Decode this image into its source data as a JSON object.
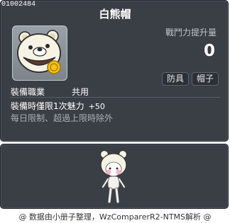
{
  "item": {
    "code": "01002484",
    "name": "白熊帽",
    "icon": "white-bear-hat-icon"
  },
  "stats": {
    "power_label": "戰鬥力提升量",
    "power_value": "0"
  },
  "tags": {
    "armor": "防具",
    "hat": "帽子"
  },
  "job": {
    "label": "裝備職業",
    "value": "共用"
  },
  "bonus": {
    "text": "裝備時僅限1次魅力",
    "stat": "+50",
    "limit": "每日限制、超過上限時除外"
  },
  "avatar": {
    "icon": "character-avatar-icon"
  },
  "footer": {
    "text": "@ 数据由小册子整理，WzComparerR2-NTMS解析 @"
  },
  "colors": {
    "panel_bg": "#3a3f46",
    "panel_border": "#24282d",
    "text_primary": "#ffffff",
    "text_secondary": "#a9aeb3"
  }
}
